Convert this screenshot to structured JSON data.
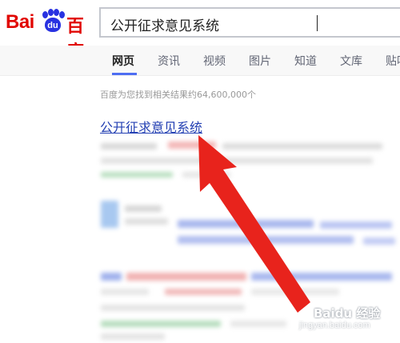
{
  "logo": {
    "latin": "Bai",
    "badge": "du",
    "chinese": "百度"
  },
  "search": {
    "query": "公开征求意见系统"
  },
  "tabs": [
    {
      "label": "网页",
      "active": true
    },
    {
      "label": "资讯"
    },
    {
      "label": "视频"
    },
    {
      "label": "图片"
    },
    {
      "label": "知道"
    },
    {
      "label": "文库"
    },
    {
      "label": "贴吧"
    }
  ],
  "results": {
    "stats": "百度为您找到相关结果约64,600,000个",
    "first_title": "公开征求意见系统"
  },
  "annotation": {
    "arrow_color": "#e8231c"
  },
  "watermark": {
    "text": "Baidu 经验",
    "sub": "jingyan.baidu.com"
  },
  "colors": {
    "brand_red": "#e10602",
    "brand_blue": "#2932e1",
    "link": "#2440b3",
    "accent": "#4e6ef2"
  }
}
